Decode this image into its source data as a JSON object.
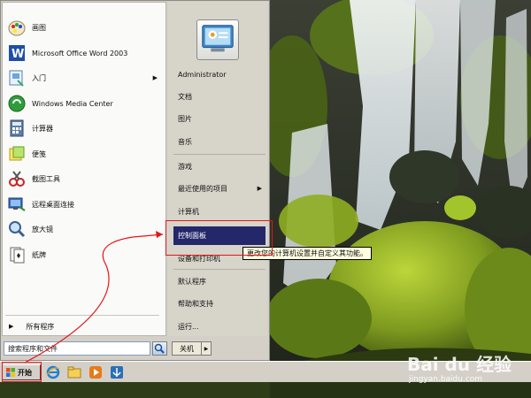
{
  "start_menu": {
    "pinned_programs": [
      {
        "label": "画图",
        "icon": "paint-icon"
      },
      {
        "label": "Microsoft Office Word 2003",
        "icon": "word-icon"
      },
      {
        "label": "入门",
        "icon": "getting-started-icon",
        "has_submenu": true
      },
      {
        "label": "Windows Media Center",
        "icon": "media-center-icon"
      },
      {
        "label": "计算器",
        "icon": "calculator-icon"
      },
      {
        "label": "便笺",
        "icon": "sticky-notes-icon"
      },
      {
        "label": "截图工具",
        "icon": "snipping-tool-icon"
      },
      {
        "label": "远程桌面连接",
        "icon": "remote-desktop-icon"
      },
      {
        "label": "放大镜",
        "icon": "magnifier-icon"
      },
      {
        "label": "纸牌",
        "icon": "solitaire-icon"
      }
    ],
    "all_programs_label": "所有程序",
    "search": {
      "value": "搜索程序和文件",
      "placeholder": "搜索程序和文件"
    },
    "shutdown_label": "关机",
    "right_items": [
      {
        "label": "Administrator"
      },
      {
        "label": "文档"
      },
      {
        "label": "图片"
      },
      {
        "label": "音乐"
      },
      {
        "label": "游戏"
      },
      {
        "label": "最近使用的项目",
        "has_submenu": true
      },
      {
        "label": "计算机"
      },
      {
        "label": "控制面板",
        "highlighted": true
      },
      {
        "label": "设备和打印机"
      },
      {
        "label": "默认程序"
      },
      {
        "label": "帮助和支持"
      },
      {
        "label": "运行..."
      }
    ],
    "tooltip": "更改您的计算机设置并自定义其功能。"
  },
  "taskbar": {
    "start_label": "开始",
    "quick_launch": [
      "ie-icon",
      "explorer-icon",
      "media-player-icon",
      "extra-app-icon"
    ]
  },
  "watermark": {
    "logo": "Bai du 经验",
    "url": "jingyan.baidu.com"
  },
  "colors": {
    "highlight": "#24276a",
    "annotation": "#e5161c",
    "tooltip_bg": "#ffffe1"
  }
}
